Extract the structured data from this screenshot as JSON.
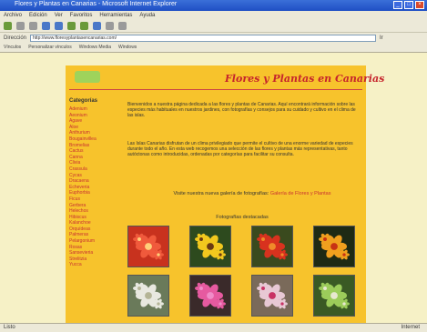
{
  "window": {
    "title": "Flores y Plantas en Canarias - Microsoft Internet Explorer"
  },
  "menu": [
    "Archivo",
    "Edición",
    "Ver",
    "Favoritos",
    "Herramientas",
    "Ayuda"
  ],
  "address": {
    "label": "Dirección",
    "url": "http://www.floresyplantasencanarias.com/",
    "go": "Ir"
  },
  "links": [
    "Vínculos",
    "Personalizar vínculos",
    "Windows Media",
    "Windows"
  ],
  "site": {
    "title": "Flores y Plantas en Canarias",
    "sidebar_heading": "Categorías",
    "sidebar_items": [
      "Adenium",
      "Aeonium",
      "Agave",
      "Aloe",
      "Anthurium",
      "Bougainvillea",
      "Bromelias",
      "Cactus",
      "Canna",
      "Clivia",
      "Crassula",
      "Cycas",
      "Dracaena",
      "Echeveria",
      "Euphorbia",
      "Ficus",
      "Gerbera",
      "Helechos",
      "Hibiscus",
      "Kalanchoe",
      "Orquídeas",
      "Palmeras",
      "Pelargonium",
      "Rosas",
      "Sansevieria",
      "Strelitzia",
      "Yucca"
    ],
    "para1": "Bienvenidos a nuestra página dedicada a las flores y plantas de Canarias. Aquí encontrará información sobre las especies más habituales en nuestros jardines, con fotografías y consejos para su cuidado y cultivo en el clima de las islas.",
    "para2": "Las Islas Canarias disfrutan de un clima privilegiado que permite el cultivo de una enorme variedad de especies durante todo el año. En esta web recogemos una selección de las flores y plantas más representativas, tanto autóctonas como introducidas, ordenadas por categorías para facilitar su consulta.",
    "promo_text": "Visite nuestra nueva galería de fotografías: ",
    "promo_link": "Galería de Flores y Plantas",
    "photo_heading": "Fotografías destacadas"
  },
  "photos": [
    {
      "name": "red-begonia",
      "bg": "#c8321e",
      "petal": "#f05a3c",
      "center": "#ffd07a"
    },
    {
      "name": "sunflower",
      "bg": "#2d4a1e",
      "petal": "#f2c81e",
      "center": "#6a3a12"
    },
    {
      "name": "red-flowers",
      "bg": "#3a4a1e",
      "petal": "#d8321e",
      "center": "#f08a2a"
    },
    {
      "name": "orange-lily",
      "bg": "#1e2a14",
      "petal": "#f0a01e",
      "center": "#c83214"
    },
    {
      "name": "white-blossoms",
      "bg": "#6a7a5a",
      "petal": "#e8e8e0",
      "center": "#b4b496"
    },
    {
      "name": "pink-rose",
      "bg": "#3a2a2a",
      "petal": "#e65aa0",
      "center": "#f08cc8"
    },
    {
      "name": "pink-orchid",
      "bg": "#7a6a5a",
      "petal": "#e8c8d4",
      "center": "#c83264"
    },
    {
      "name": "green-plant",
      "bg": "#3a5a24",
      "petal": "#9ccc5a",
      "center": "#e8e8d0"
    }
  ],
  "status": {
    "text": "Listo",
    "zone": "Internet"
  }
}
